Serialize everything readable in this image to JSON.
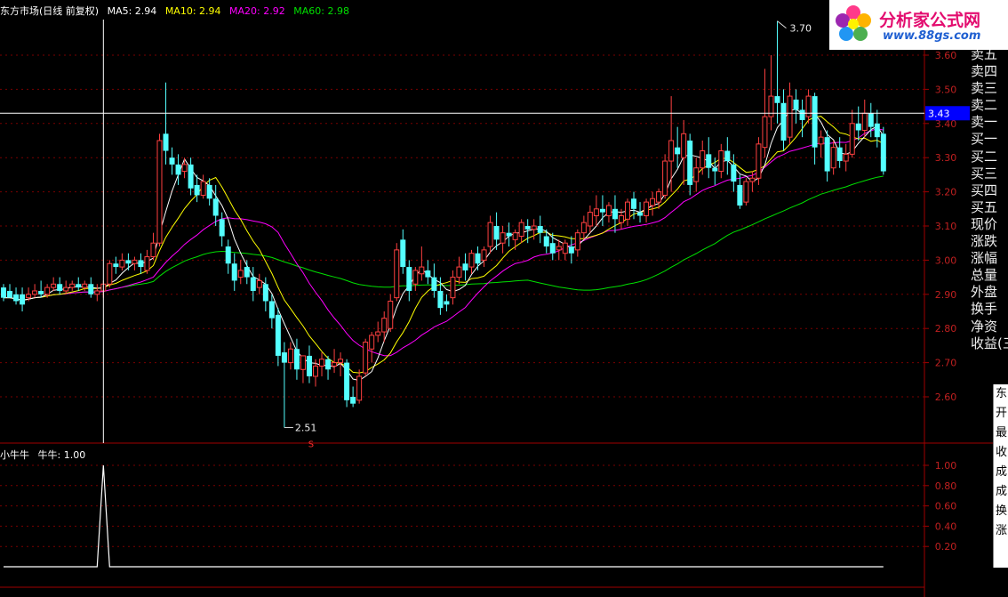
{
  "header": {
    "title": "东方市场(日线 前复权)",
    "ma5": "MA5: 2.94",
    "ma10": "MA10: 2.94",
    "ma20": "MA20: 2.92",
    "ma60": "MA60: 2.98"
  },
  "sub_header": {
    "name": "小牛牛",
    "value": "牛牛: 1.00"
  },
  "side_labels": [
    "卖五",
    "卖四",
    "卖三",
    "卖二",
    "卖一",
    "买一",
    "买二",
    "买三",
    "买四",
    "买五",
    "现价",
    "涨跌",
    "涨幅",
    "总量",
    "外盘",
    "换手",
    "净资",
    "收益(三"
  ],
  "logo": {
    "title": "分析家公式网",
    "url": "www.88gs.com"
  },
  "info_panel": [
    "东",
    "开",
    "最",
    "收",
    "成",
    "成",
    "换",
    "涨"
  ],
  "colors": {
    "up": "#ff4040",
    "down": "#54ffff",
    "ma5": "#ffffff",
    "ma10": "#ffff00",
    "ma20": "#ff00ff",
    "ma60": "#00e000",
    "crosshair_tag": "#0000ff"
  },
  "chart_data": [
    {
      "type": "candlestick",
      "yticks": [
        "3.60",
        "3.50",
        "3.40",
        "3.30",
        "3.20",
        "3.10",
        "3.00",
        "2.90",
        "2.80",
        "2.70",
        "2.60"
      ],
      "ylim": [
        2.55,
        3.62
      ],
      "annotations": {
        "high": "3.70",
        "low": "2.51",
        "signal": "S",
        "crosshair_price": "3.43"
      },
      "candles": [
        [
          2.92,
          2.93,
          2.89,
          2.88
        ],
        [
          2.91,
          2.93,
          2.89,
          2.9
        ],
        [
          2.9,
          2.92,
          2.88,
          2.87
        ],
        [
          2.9,
          2.92,
          2.87,
          2.85
        ],
        [
          2.89,
          2.92,
          2.9,
          2.88
        ],
        [
          2.9,
          2.93,
          2.91,
          2.89
        ],
        [
          2.91,
          2.94,
          2.9,
          2.89
        ],
        [
          2.9,
          2.93,
          2.92,
          2.89
        ],
        [
          2.92,
          2.95,
          2.93,
          2.91
        ],
        [
          2.93,
          2.95,
          2.91,
          2.9
        ],
        [
          2.91,
          2.94,
          2.92,
          2.9
        ],
        [
          2.92,
          2.94,
          2.93,
          2.91
        ],
        [
          2.93,
          2.95,
          2.92,
          2.91
        ],
        [
          2.92,
          2.94,
          2.93,
          2.91
        ],
        [
          2.93,
          2.95,
          2.9,
          2.89
        ],
        [
          2.9,
          2.93,
          2.91,
          2.88
        ],
        [
          2.91,
          2.94,
          2.93,
          2.89
        ],
        [
          2.93,
          3.0,
          2.99,
          2.92
        ],
        [
          2.99,
          3.01,
          2.98,
          2.96
        ],
        [
          2.98,
          3.02,
          3.0,
          2.97
        ],
        [
          3.0,
          3.02,
          2.99,
          2.97
        ],
        [
          2.99,
          3.01,
          3.0,
          2.97
        ],
        [
          3.0,
          3.02,
          2.98,
          2.96
        ],
        [
          2.97,
          3.03,
          3.01,
          2.96
        ],
        [
          3.01,
          3.08,
          3.05,
          3.0
        ],
        [
          3.05,
          3.37,
          3.35,
          3.04
        ],
        [
          3.37,
          3.52,
          3.32,
          3.28
        ],
        [
          3.3,
          3.33,
          3.28,
          3.25
        ],
        [
          3.28,
          3.31,
          3.25,
          3.22
        ],
        [
          3.26,
          3.3,
          3.28,
          3.24
        ],
        [
          3.28,
          3.3,
          3.21,
          3.19
        ],
        [
          3.22,
          3.25,
          3.19,
          3.17
        ],
        [
          3.19,
          3.25,
          3.23,
          3.18
        ],
        [
          3.22,
          3.24,
          3.18,
          3.16
        ],
        [
          3.18,
          3.22,
          3.13,
          3.1
        ],
        [
          3.12,
          3.14,
          3.07,
          3.04
        ],
        [
          3.04,
          3.06,
          2.99,
          2.96
        ],
        [
          2.99,
          3.02,
          2.94,
          2.91
        ],
        [
          2.95,
          3.0,
          2.97,
          2.93
        ],
        [
          2.98,
          3.0,
          2.95,
          2.93
        ],
        [
          2.95,
          2.98,
          2.91,
          2.88
        ],
        [
          2.92,
          2.96,
          2.94,
          2.9
        ],
        [
          2.93,
          2.95,
          2.88,
          2.85
        ],
        [
          2.88,
          2.9,
          2.83,
          2.8
        ],
        [
          2.84,
          2.86,
          2.72,
          2.69
        ],
        [
          2.73,
          2.76,
          2.7,
          2.51
        ],
        [
          2.7,
          2.76,
          2.74,
          2.68
        ],
        [
          2.74,
          2.77,
          2.68,
          2.65
        ],
        [
          2.68,
          2.71,
          2.72,
          2.64
        ],
        [
          2.72,
          2.75,
          2.66,
          2.64
        ],
        [
          2.66,
          2.71,
          2.69,
          2.63
        ],
        [
          2.69,
          2.73,
          2.71,
          2.66
        ],
        [
          2.71,
          2.72,
          2.68,
          2.65
        ],
        [
          2.69,
          2.74,
          2.7,
          2.67
        ],
        [
          2.7,
          2.73,
          2.71,
          2.66
        ],
        [
          2.7,
          2.71,
          2.59,
          2.57
        ],
        [
          2.6,
          2.63,
          2.58,
          2.57
        ],
        [
          2.59,
          2.68,
          2.66,
          2.58
        ],
        [
          2.67,
          2.77,
          2.76,
          2.66
        ],
        [
          2.74,
          2.79,
          2.78,
          2.7
        ],
        [
          2.78,
          2.82,
          2.79,
          2.76
        ],
        [
          2.79,
          2.85,
          2.83,
          2.76
        ],
        [
          2.8,
          2.9,
          2.88,
          2.79
        ],
        [
          2.89,
          3.05,
          3.03,
          2.88
        ],
        [
          3.06,
          3.09,
          2.98,
          2.96
        ],
        [
          2.98,
          3.0,
          2.91,
          2.88
        ],
        [
          2.93,
          2.98,
          2.97,
          2.91
        ],
        [
          2.96,
          3.04,
          2.98,
          2.94
        ],
        [
          2.97,
          3.0,
          2.95,
          2.93
        ],
        [
          2.95,
          2.99,
          2.91,
          2.89
        ],
        [
          2.91,
          2.95,
          2.86,
          2.84
        ],
        [
          2.88,
          2.9,
          2.87,
          2.85
        ],
        [
          2.89,
          2.97,
          2.95,
          2.87
        ],
        [
          2.95,
          3.01,
          2.98,
          2.93
        ],
        [
          2.99,
          3.02,
          2.97,
          2.94
        ],
        [
          2.98,
          3.03,
          3.02,
          2.96
        ],
        [
          3.02,
          3.04,
          2.99,
          2.97
        ],
        [
          3.0,
          3.04,
          3.03,
          2.98
        ],
        [
          3.04,
          3.13,
          3.11,
          3.02
        ],
        [
          3.1,
          3.14,
          3.06,
          3.03
        ],
        [
          3.05,
          3.1,
          3.08,
          3.02
        ],
        [
          3.08,
          3.11,
          3.07,
          3.04
        ],
        [
          3.06,
          3.09,
          3.08,
          3.03
        ],
        [
          3.07,
          3.12,
          3.11,
          3.05
        ],
        [
          3.1,
          3.12,
          3.09,
          3.05
        ],
        [
          3.09,
          3.12,
          3.1,
          3.06
        ],
        [
          3.1,
          3.13,
          3.08,
          3.05
        ],
        [
          3.07,
          3.09,
          3.04,
          3.02
        ],
        [
          3.05,
          3.08,
          3.02,
          3.0
        ],
        [
          3.03,
          3.06,
          3.04,
          3.0
        ],
        [
          3.02,
          3.06,
          3.05,
          3.0
        ],
        [
          3.04,
          3.07,
          3.02,
          2.99
        ],
        [
          3.03,
          3.09,
          3.08,
          3.01
        ],
        [
          3.08,
          3.13,
          3.11,
          3.06
        ],
        [
          3.1,
          3.16,
          3.14,
          3.08
        ],
        [
          3.13,
          3.19,
          3.15,
          3.1
        ],
        [
          3.15,
          3.19,
          3.14,
          3.1
        ],
        [
          3.13,
          3.17,
          3.16,
          3.11
        ],
        [
          3.15,
          3.19,
          3.12,
          3.08
        ],
        [
          3.11,
          3.15,
          3.13,
          3.09
        ],
        [
          3.12,
          3.18,
          3.17,
          3.1
        ],
        [
          3.18,
          3.2,
          3.15,
          3.12
        ],
        [
          3.14,
          3.17,
          3.13,
          3.11
        ],
        [
          3.13,
          3.18,
          3.17,
          3.11
        ],
        [
          3.16,
          3.2,
          3.18,
          3.13
        ],
        [
          3.17,
          3.21,
          3.2,
          3.15
        ],
        [
          3.19,
          3.31,
          3.29,
          3.18
        ],
        [
          3.29,
          3.48,
          3.35,
          3.2
        ],
        [
          3.33,
          3.39,
          3.31,
          3.27
        ],
        [
          3.3,
          3.41,
          3.37,
          3.22
        ],
        [
          3.35,
          3.37,
          3.22,
          3.19
        ],
        [
          3.23,
          3.3,
          3.27,
          3.2
        ],
        [
          3.27,
          3.35,
          3.32,
          3.25
        ],
        [
          3.31,
          3.36,
          3.27,
          3.24
        ],
        [
          3.27,
          3.3,
          3.26,
          3.22
        ],
        [
          3.26,
          3.34,
          3.32,
          3.24
        ],
        [
          3.32,
          3.36,
          3.29,
          3.25
        ],
        [
          3.28,
          3.31,
          3.23,
          3.2
        ],
        [
          3.22,
          3.25,
          3.16,
          3.15
        ],
        [
          3.17,
          3.24,
          3.23,
          3.16
        ],
        [
          3.23,
          3.26,
          3.24,
          3.2
        ],
        [
          3.24,
          3.36,
          3.34,
          3.22
        ],
        [
          3.33,
          3.56,
          3.42,
          3.3
        ],
        [
          3.42,
          3.6,
          3.48,
          3.38
        ],
        [
          3.48,
          3.7,
          3.46,
          3.4
        ],
        [
          3.46,
          3.5,
          3.35,
          3.32
        ],
        [
          3.36,
          3.52,
          3.48,
          3.34
        ],
        [
          3.47,
          3.5,
          3.44,
          3.4
        ],
        [
          3.44,
          3.47,
          3.41,
          3.36
        ],
        [
          3.42,
          3.5,
          3.48,
          3.4
        ],
        [
          3.48,
          3.49,
          3.33,
          3.28
        ],
        [
          3.34,
          3.38,
          3.36,
          3.3
        ],
        [
          3.36,
          3.38,
          3.26,
          3.23
        ],
        [
          3.27,
          3.35,
          3.33,
          3.25
        ],
        [
          3.33,
          3.36,
          3.29,
          3.27
        ],
        [
          3.29,
          3.34,
          3.31,
          3.26
        ],
        [
          3.31,
          3.44,
          3.4,
          3.3
        ],
        [
          3.4,
          3.45,
          3.38,
          3.35
        ],
        [
          3.38,
          3.47,
          3.43,
          3.36
        ],
        [
          3.43,
          3.46,
          3.39,
          3.36
        ],
        [
          3.4,
          3.44,
          3.36,
          3.33
        ],
        [
          3.37,
          3.39,
          3.26,
          3.25
        ]
      ]
    },
    {
      "type": "line",
      "series": [
        {
          "name": "牛牛"
        }
      ],
      "yticks": [
        "1.00",
        "0.80",
        "0.60",
        "0.40",
        "0.20"
      ],
      "ylim": [
        0,
        1.05
      ],
      "spike_index": 16,
      "spike_value": 1.0
    }
  ]
}
